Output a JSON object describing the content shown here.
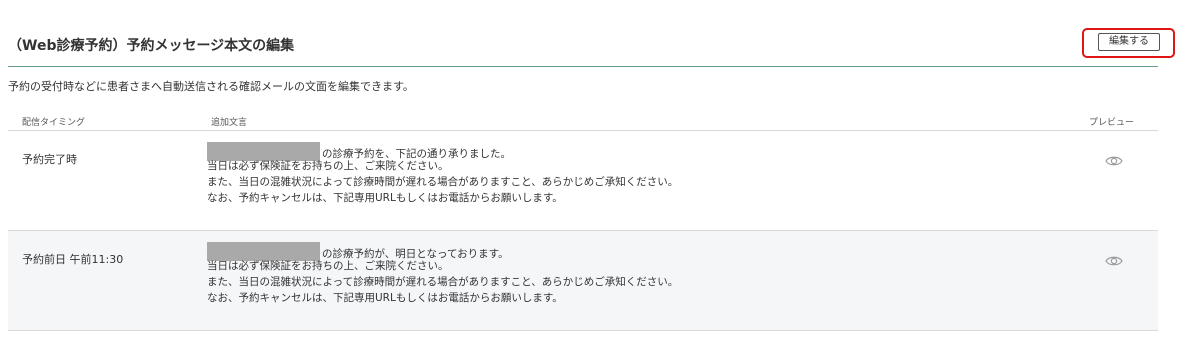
{
  "header": {
    "title": "（Web診療予約）予約メッセージ本文の編集",
    "edit_button_label": "編集する"
  },
  "description": "予約の受付時などに患者さまへ自動送信される確認メールの文面を編集できます。",
  "table": {
    "columns": {
      "timing": "配信タイミング",
      "text": "追加文言",
      "preview": "プレビュー"
    },
    "rows": [
      {
        "timing": "予約完了時",
        "lines": [
          "の診療予約を、下記の通り承りました。",
          "当日は必ず保険証をお持ちの上、ご来院ください。",
          "また、当日の混雑状況によって診療時間が遅れる場合がありますこと、あらかじめご承知ください。",
          "なお、予約キャンセルは、下記専用URLもしくはお電話からお願いします。"
        ],
        "preview_icon": "eye-icon"
      },
      {
        "timing": "予約前日 午前11:30",
        "lines": [
          "の診療予約が、明日となっております。",
          "当日は必ず保険証をお持ちの上、ご来院ください。",
          "また、当日の混雑状況によって診療時間が遅れる場合がありますこと、あらかじめご承知ください。",
          "なお、予約キャンセルは、下記専用URLもしくはお電話からお願いします。"
        ],
        "preview_icon": "eye-icon"
      }
    ]
  },
  "colors": {
    "accent_line": "#6aa08a",
    "highlight": "#e01515",
    "alt_row": "#f5f6f8",
    "redaction": "#a9a9a9"
  }
}
